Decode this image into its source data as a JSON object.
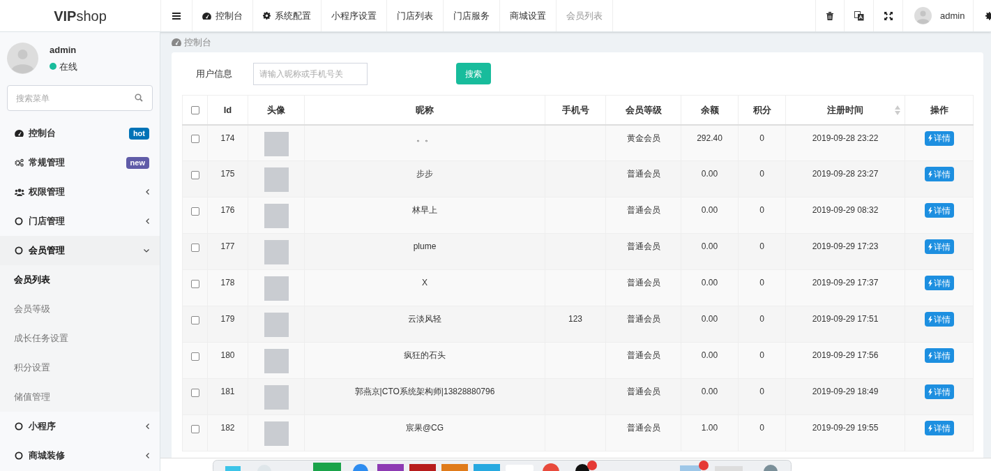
{
  "logo": "**VIP**shop",
  "topnav": [
    {
      "label": "控制台",
      "selected": false
    },
    {
      "label": "系统配置",
      "selected": false
    },
    {
      "label": "小程序设置",
      "selected": false
    },
    {
      "label": "门店列表",
      "selected": false
    },
    {
      "label": "门店服务",
      "selected": false
    },
    {
      "label": "商城设置",
      "selected": false
    },
    {
      "label": "会员列表",
      "selected": true
    }
  ],
  "user": {
    "name": "admin",
    "status": "在线"
  },
  "top_user": "admin",
  "menu_search": {
    "placeholder": "搜索菜单"
  },
  "menu": [
    {
      "label": "控制台",
      "kind": "gauge",
      "badge": {
        "text": "hot",
        "color": "#0073b7"
      }
    },
    {
      "label": "常规管理",
      "kind": "cogs",
      "badge": {
        "text": "new",
        "color": "#605ca8"
      }
    },
    {
      "label": "权限管理",
      "kind": "users",
      "expanded": false
    },
    {
      "label": "门店管理",
      "kind": "circle",
      "expanded": false
    },
    {
      "label": "会员管理",
      "kind": "circle",
      "expanded": true,
      "children": [
        {
          "label": "会员列表",
          "selected": true
        },
        {
          "label": "会员等级",
          "selected": false
        },
        {
          "label": "成长任务设置",
          "selected": false
        },
        {
          "label": "积分设置",
          "selected": false
        },
        {
          "label": "储值管理",
          "selected": false
        }
      ]
    },
    {
      "label": "小程序",
      "kind": "circle",
      "expanded": false
    },
    {
      "label": "商城装修",
      "kind": "circle",
      "expanded": false
    }
  ],
  "breadcrumb": "控制台",
  "search_form": {
    "label": "用户信息",
    "placeholder": "请输入昵称或手机号关",
    "button": "搜索"
  },
  "table": {
    "columns": [
      {
        "label": "Id",
        "sortable": false
      },
      {
        "label": "头像",
        "sortable": false
      },
      {
        "label": "昵称",
        "sortable": false
      },
      {
        "label": "手机号",
        "sortable": false
      },
      {
        "label": "会员等级",
        "sortable": false
      },
      {
        "label": "余额",
        "sortable": false
      },
      {
        "label": "积分",
        "sortable": false
      },
      {
        "label": "注册时间",
        "sortable": true
      },
      {
        "label": "操作",
        "sortable": false
      }
    ],
    "header_checked": false,
    "rows": [
      {
        "checked": false,
        "id": "174",
        "nickname": "。。",
        "phone": "",
        "level": "黄金会员",
        "balance": "292.40",
        "points": "0",
        "registered": "2019-09-28 23:22",
        "action": "详情"
      },
      {
        "checked": false,
        "id": "175",
        "nickname": "步步",
        "phone": "",
        "level": "普通会员",
        "balance": "0.00",
        "points": "0",
        "registered": "2019-09-28 23:27",
        "action": "详情"
      },
      {
        "checked": false,
        "id": "176",
        "nickname": "林早上",
        "phone": "",
        "level": "普通会员",
        "balance": "0.00",
        "points": "0",
        "registered": "2019-09-29 08:32",
        "action": "详情"
      },
      {
        "checked": false,
        "id": "177",
        "nickname": "plume",
        "phone": "",
        "level": "普通会员",
        "balance": "0.00",
        "points": "0",
        "registered": "2019-09-29 17:23",
        "action": "详情"
      },
      {
        "checked": false,
        "id": "178",
        "nickname": "X",
        "phone": "",
        "level": "普通会员",
        "balance": "0.00",
        "points": "0",
        "registered": "2019-09-29 17:37",
        "action": "详情"
      },
      {
        "checked": false,
        "id": "179",
        "nickname": "云淡风轻",
        "phone": "123",
        "level": "普通会员",
        "balance": "0.00",
        "points": "0",
        "registered": "2019-09-29 17:51",
        "action": "详情"
      },
      {
        "checked": false,
        "id": "180",
        "nickname": "疯狂的石头",
        "phone": "",
        "level": "普通会员",
        "balance": "0.00",
        "points": "0",
        "registered": "2019-09-29 17:56",
        "action": "详情"
      },
      {
        "checked": false,
        "id": "181",
        "nickname": "郭燕京|CTO系统架构师|13828880796",
        "phone": "",
        "level": "普通会员",
        "balance": "0.00",
        "points": "0",
        "registered": "2019-09-29 18:49",
        "action": "详情"
      },
      {
        "checked": false,
        "id": "182",
        "nickname": "宸果@CG",
        "phone": "",
        "level": "普通会员",
        "balance": "1.00",
        "points": "0",
        "registered": "2019-09-29 19:55",
        "action": "详情"
      }
    ]
  }
}
